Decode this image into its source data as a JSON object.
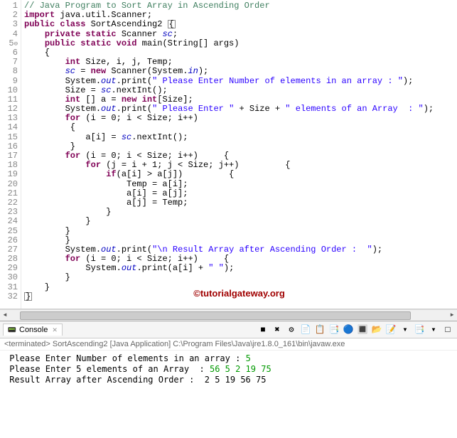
{
  "watermark": "©tutorialgateway.org",
  "code": {
    "lines": [
      {
        "n": "1",
        "t": "comment",
        "text": "// Java Program to Sort Array in Ascending Order"
      },
      {
        "n": "2",
        "t": "import",
        "parts": [
          "import",
          " java.util.Scanner;"
        ]
      },
      {
        "n": "3",
        "t": "class",
        "parts": [
          "public class",
          " SortAscending2 "
        ]
      },
      {
        "n": "4",
        "t": "field",
        "parts": [
          "    ",
          "private static",
          " Scanner ",
          "sc",
          ";"
        ]
      },
      {
        "n": "5",
        "t": "method",
        "parts": [
          "    ",
          "public static void",
          " main(String[] args)"
        ],
        "fold": true
      },
      {
        "n": "6",
        "t": "plain",
        "text": "    {"
      },
      {
        "n": "7",
        "t": "decl",
        "parts": [
          "        ",
          "int",
          " Size, i, j, Temp;"
        ]
      },
      {
        "n": "8",
        "t": "assign",
        "parts": [
          "        ",
          "sc",
          " = ",
          "new",
          " Scanner(System.",
          "in",
          ");"
        ]
      },
      {
        "n": "9",
        "t": "print",
        "parts": [
          "        System.",
          "out",
          ".print(",
          "\" Please Enter Number of elements in an array : \"",
          ");"
        ]
      },
      {
        "n": "10",
        "t": "stmt",
        "parts": [
          "        Size = ",
          "sc",
          ".nextInt();"
        ]
      },
      {
        "n": "11",
        "t": "decl",
        "parts": [
          "        ",
          "int",
          " [] a = ",
          "new int",
          "[Size];"
        ]
      },
      {
        "n": "12",
        "t": "print",
        "parts": [
          "        System.",
          "out",
          ".print(",
          "\" Please Enter \"",
          " + Size + ",
          "\" elements of an Array  : \"",
          ");"
        ]
      },
      {
        "n": "13",
        "t": "for",
        "parts": [
          "        ",
          "for",
          " (i = 0; i < Size; i++)"
        ]
      },
      {
        "n": "14",
        "t": "plain",
        "text": "         {"
      },
      {
        "n": "15",
        "t": "stmt",
        "parts": [
          "            a[i] = ",
          "sc",
          ".nextInt();"
        ]
      },
      {
        "n": "16",
        "t": "plain",
        "text": "         }"
      },
      {
        "n": "17",
        "t": "for",
        "parts": [
          "        ",
          "for",
          " (i = 0; i < Size; i++)     {"
        ]
      },
      {
        "n": "18",
        "t": "for",
        "parts": [
          "            ",
          "for",
          " (j = i + 1; j < Size; j++)         {"
        ]
      },
      {
        "n": "19",
        "t": "if",
        "parts": [
          "                ",
          "if",
          "(a[i] > a[j])         {"
        ]
      },
      {
        "n": "20",
        "t": "plain",
        "text": "                    Temp = a[i];"
      },
      {
        "n": "21",
        "t": "plain",
        "text": "                    a[i] = a[j];"
      },
      {
        "n": "22",
        "t": "plain",
        "text": "                    a[j] = Temp;"
      },
      {
        "n": "23",
        "t": "plain",
        "text": "                }"
      },
      {
        "n": "24",
        "t": "plain",
        "text": "            }"
      },
      {
        "n": "25",
        "t": "plain",
        "text": "        }"
      },
      {
        "n": "26",
        "t": "plain",
        "text": "        }"
      },
      {
        "n": "27",
        "t": "print",
        "parts": [
          "        System.",
          "out",
          ".print(",
          "\"\\n Result Array after Ascending Order :  \"",
          ");"
        ]
      },
      {
        "n": "28",
        "t": "for",
        "parts": [
          "        ",
          "for",
          " (i = 0; i < Size; i++)     {"
        ]
      },
      {
        "n": "29",
        "t": "print",
        "parts": [
          "            System.",
          "out",
          ".print(a[i] + ",
          "\" \"",
          ");"
        ]
      },
      {
        "n": "30",
        "t": "plain",
        "text": "        }"
      },
      {
        "n": "31",
        "t": "plain",
        "text": "    }"
      },
      {
        "n": "32",
        "t": "close",
        "text": "}"
      }
    ]
  },
  "console": {
    "tab_label": "Console",
    "close_x": "✕",
    "status": "<terminated> SortAscending2 [Java Application] C:\\Program Files\\Java\\jre1.8.0_161\\bin\\javaw.exe",
    "lines": [
      {
        "prompt": " Please Enter Number of elements in an array : ",
        "input": "5"
      },
      {
        "prompt": " Please Enter 5 elements of an Array  : ",
        "input": "56 5 2 19 75"
      },
      {
        "prompt": "",
        "input": ""
      },
      {
        "prompt": " Result Array after Ascending Order :  2 5 19 56 75",
        "input": ""
      }
    ]
  },
  "toolbar_icons": [
    "■",
    "✖",
    "⚙",
    "📄",
    "📋",
    "📑",
    "🔵",
    "🔳",
    "📂",
    "📝",
    "▾",
    "📑",
    "▾",
    "□"
  ]
}
